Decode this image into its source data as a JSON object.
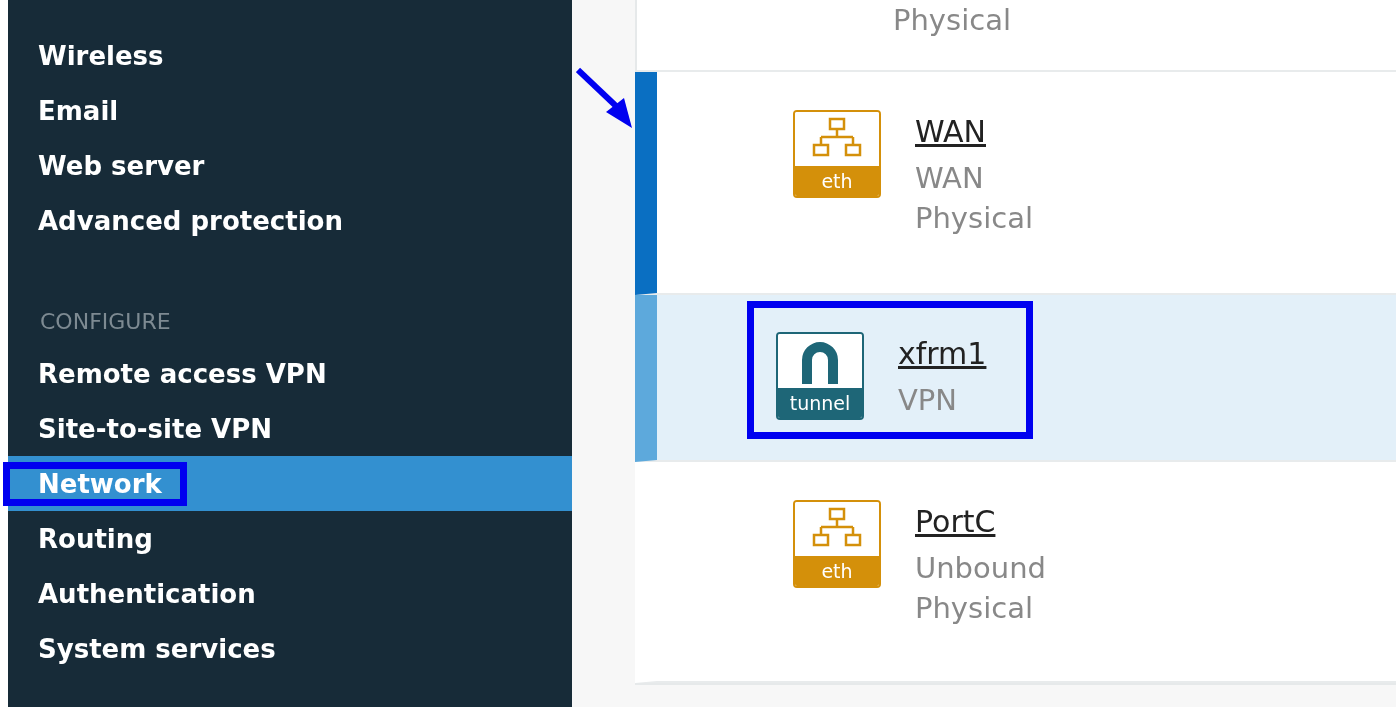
{
  "sidebar": {
    "items": [
      {
        "kind": "item",
        "label": "Wireless",
        "selected": false,
        "annotated": false
      },
      {
        "kind": "item",
        "label": "Email",
        "selected": false,
        "annotated": false
      },
      {
        "kind": "item",
        "label": "Web server",
        "selected": false,
        "annotated": false
      },
      {
        "kind": "item",
        "label": "Advanced protection",
        "selected": false,
        "annotated": false
      },
      {
        "kind": "heading",
        "label": "CONFIGURE"
      },
      {
        "kind": "item",
        "label": "Remote access VPN",
        "selected": false,
        "annotated": false
      },
      {
        "kind": "item",
        "label": "Site-to-site VPN",
        "selected": false,
        "annotated": false
      },
      {
        "kind": "item",
        "label": "Network",
        "selected": true,
        "annotated": true
      },
      {
        "kind": "item",
        "label": "Routing",
        "selected": false,
        "annotated": false
      },
      {
        "kind": "item",
        "label": "Authentication",
        "selected": false,
        "annotated": false
      },
      {
        "kind": "item",
        "label": "System services",
        "selected": false,
        "annotated": false
      }
    ]
  },
  "interfaces": {
    "top_remainder": "Physical",
    "rows": [
      {
        "kind": "eth",
        "icon_label": "eth",
        "name": "WAN",
        "details": [
          "WAN",
          "Physical"
        ],
        "selected": false,
        "focused": true,
        "annotated": false,
        "pointed": true
      },
      {
        "kind": "tunnel",
        "icon_label": "tunnel",
        "name": "xfrm1",
        "details": [
          "VPN"
        ],
        "selected": true,
        "focused": false,
        "annotated": true,
        "pointed": false
      },
      {
        "kind": "eth",
        "icon_label": "eth",
        "name": "PortC",
        "details": [
          "Unbound",
          "Physical"
        ],
        "selected": false,
        "focused": false,
        "annotated": false,
        "pointed": false
      }
    ]
  }
}
